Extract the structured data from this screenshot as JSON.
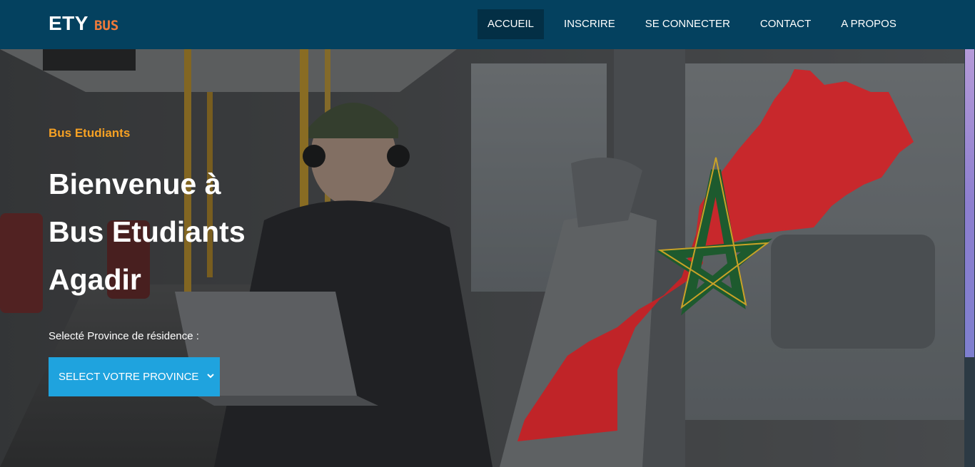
{
  "brand": {
    "main": "ETY",
    "sub": "BUS"
  },
  "nav": {
    "items": [
      {
        "label": "ACCUEIL",
        "active": true
      },
      {
        "label": "INSCRIRE",
        "active": false
      },
      {
        "label": "SE CONNECTER",
        "active": false
      },
      {
        "label": "CONTACT",
        "active": false
      },
      {
        "label": "A PROPOS",
        "active": false
      }
    ]
  },
  "hero": {
    "eyebrow": "Bus Etudiants",
    "title_lines": [
      "Bienvenue à",
      "Bus Etudiants",
      "Agadir"
    ],
    "select_label": "Selecté Province de résidence :",
    "select_value": "SELECT VOTRE PROVINCE",
    "image": "student-in-bus-with-laptop",
    "map_image": "morocco-map-flag"
  },
  "colors": {
    "navbar": "#04415f",
    "nav_active": "#032f45",
    "brand_sub": "#f07a3a",
    "eyebrow": "#f7a123",
    "select_bg": "#1fa3de",
    "map_red": "#c8282c",
    "star_green": "#1d5a2e"
  }
}
